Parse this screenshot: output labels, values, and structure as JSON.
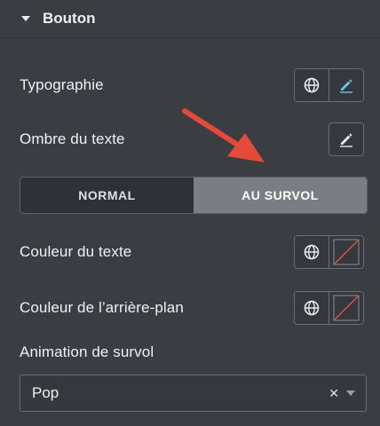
{
  "section": {
    "title": "Bouton",
    "icon": "caret-down-icon"
  },
  "typography": {
    "label": "Typographie"
  },
  "text_shadow": {
    "label": "Ombre du texte"
  },
  "state_tabs": {
    "normal": "NORMAL",
    "hover": "AU SURVOL",
    "active": "hover"
  },
  "text_color": {
    "label": "Couleur du texte"
  },
  "background_color": {
    "label": "Couleur de l’arrière-plan"
  },
  "hover_animation": {
    "label": "Animation de survol",
    "value": "Pop"
  },
  "colors": {
    "panel_bg": "#3a3d42",
    "accent_blue": "#6ec1e4",
    "annotation_arrow": "#e5493a",
    "empty_color_slash": "#d9534f"
  }
}
